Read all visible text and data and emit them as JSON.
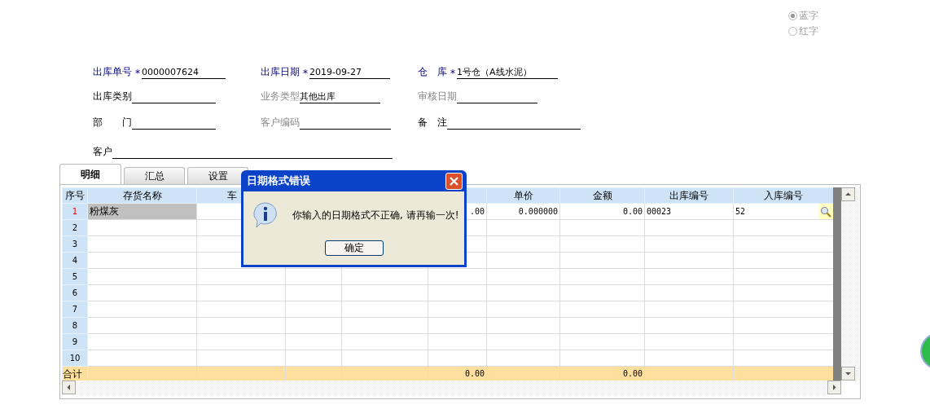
{
  "radios": [
    {
      "label": "蓝字",
      "selected": true
    },
    {
      "label": "红字",
      "selected": false
    }
  ],
  "form": [
    [
      {
        "label": "出库单号",
        "required": true,
        "mark": "*",
        "value": "0000007624"
      },
      {
        "label": "出库日期",
        "required": true,
        "mark": "*",
        "value": "2019-09-27"
      },
      {
        "label": "仓　库",
        "required": true,
        "mark": "*",
        "value": "1号仓（A线水泥）"
      }
    ],
    [
      {
        "label": "出库类别",
        "required": false,
        "disabled": false
      },
      {
        "label": "业务类型",
        "required": false,
        "disabled": true,
        "value": "其他出库"
      },
      {
        "label": "审核日期",
        "required": false,
        "disabled": true
      }
    ],
    [
      {
        "label": "部　　门",
        "required": false,
        "disabled": false
      },
      {
        "label": "客户编码",
        "required": false,
        "disabled": true
      },
      {
        "label": "备　注",
        "required": false,
        "disabled": false
      }
    ],
    [
      {
        "label": "客户",
        "required": false,
        "disabled": false
      }
    ]
  ],
  "tabs": [
    {
      "label": "明细",
      "selected": true
    },
    {
      "label": "汇总",
      "selected": false
    },
    {
      "label": "设置",
      "selected": false
    }
  ],
  "table": {
    "columns": [
      "序号",
      "存货名称",
      "车",
      null,
      null,
      null,
      "单价",
      "金额",
      "出库编号",
      "入库编号"
    ],
    "rows": [
      {
        "no": "1",
        "current": true,
        "cells": [
          "粉煤灰",
          null,
          null,
          null,
          ".00",
          "0.000000",
          "0.00",
          "00023",
          "52"
        ]
      },
      {
        "no": "2",
        "current": false
      },
      {
        "no": "3",
        "current": false
      },
      {
        "no": "4",
        "current": false
      },
      {
        "no": "5",
        "current": false
      },
      {
        "no": "6",
        "current": false
      },
      {
        "no": "7",
        "current": false
      },
      {
        "no": "8",
        "current": false
      },
      {
        "no": "9",
        "current": false
      },
      {
        "no": "10",
        "current": false
      }
    ],
    "total": {
      "label": "合计",
      "cells": [
        null,
        null,
        null,
        null,
        "0.00",
        null,
        "0.00",
        null,
        null
      ]
    }
  },
  "dialog": {
    "title": "日期格式错误",
    "message": "你输入的日期格式不正确, 请再输一次!",
    "button": "确定"
  }
}
